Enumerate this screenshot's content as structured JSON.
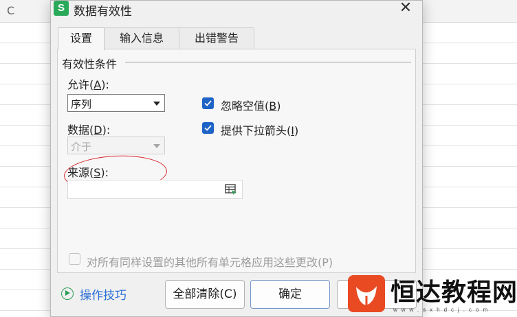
{
  "sheet": {
    "column_letter": "C"
  },
  "dialog": {
    "app_logo_letter": "S",
    "title": "数据有效性",
    "close_glyph": "✕",
    "tabs": [
      {
        "label": "设置",
        "active": true
      },
      {
        "label": "输入信息",
        "active": false
      },
      {
        "label": "出错警告",
        "active": false
      }
    ],
    "section_title": "有效性条件",
    "allow": {
      "label": "允许(",
      "key": "A",
      "tail": "):",
      "value": "序列"
    },
    "data_field": {
      "label": "数据(",
      "key": "D",
      "tail": "):",
      "value": "介于",
      "disabled": true
    },
    "ignore_blank": {
      "label": "忽略空值(",
      "key": "B",
      "tail": ")",
      "checked": true
    },
    "dropdown_arrow": {
      "label": "提供下拉箭头(",
      "key": "I",
      "tail": ")",
      "checked": true
    },
    "source": {
      "label": "来源(",
      "key": "S",
      "tail": "):",
      "value": "",
      "icon": "range-select-icon"
    },
    "apply_all": {
      "label": "对所有同样设置的其他所有单元格应用这些更改(P)",
      "checked": false,
      "disabled": true
    },
    "tips_label": "操作技巧",
    "buttons": {
      "clear_all": "全部清除(C)",
      "ok": "确定"
    }
  },
  "watermark": {
    "text": "恒达教程网",
    "sub": "www.sxhdcj.com"
  },
  "colors": {
    "accent": "#1e63c6",
    "annotation": "#d8262b",
    "link": "#2a6fd6",
    "brand": "#2aa95a"
  }
}
